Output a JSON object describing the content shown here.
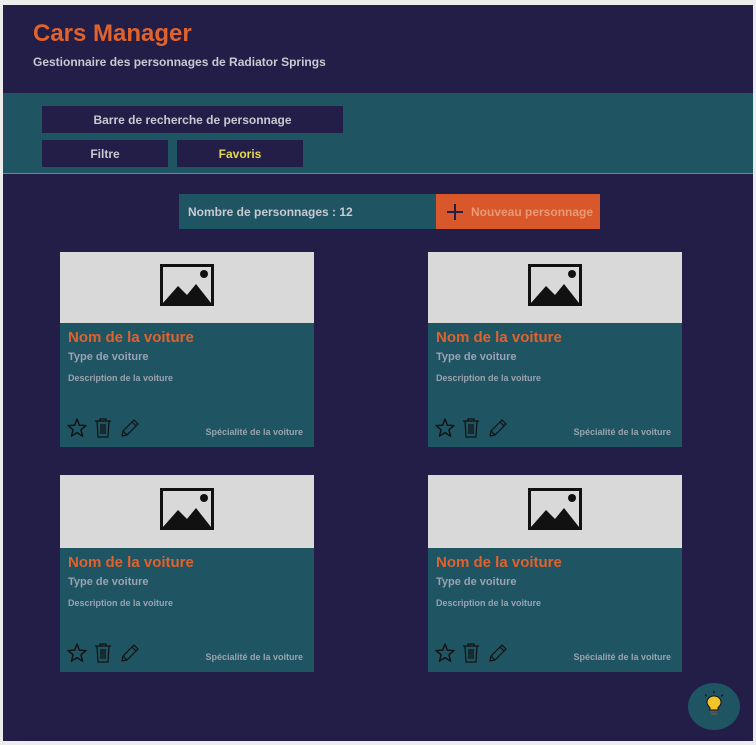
{
  "header": {
    "title": "Cars Manager",
    "subtitle": "Gestionnaire des  personnages de Radiator Springs"
  },
  "toolbar": {
    "search_label": "Barre de recherche de personnage",
    "tabs": [
      {
        "label": "Filtre"
      },
      {
        "label": "Favoris"
      }
    ]
  },
  "summary": {
    "count_label": "Nombre de personnages  : 12",
    "new_button_label": "Nouveau personnage"
  },
  "cards": [
    {
      "name": "Nom de la voiture",
      "type": "Type de voiture",
      "description": "Description de la voiture",
      "speciality": "Spécialité de la voiture"
    },
    {
      "name": "Nom de la voiture",
      "type": "Type de voiture",
      "description": "Description de la voiture",
      "speciality": "Spécialité de la voiture"
    },
    {
      "name": "Nom de la voiture",
      "type": "Type de voiture",
      "description": "Description de la voiture",
      "speciality": "Spécialité de la voiture"
    },
    {
      "name": "Nom de la voiture",
      "type": "Type de voiture",
      "description": "Description de la voiture",
      "speciality": "Spécialité de la voiture"
    }
  ],
  "icons": {
    "image_placeholder": "image-icon",
    "favorite": "star-icon",
    "delete": "trash-icon",
    "edit": "pencil-icon",
    "add": "plus-icon",
    "help": "lightbulb-icon"
  },
  "colors": {
    "background": "#221e47",
    "panel": "#1f5463",
    "accent": "#e0622c",
    "favorites_text": "#e3d94a",
    "image_bg": "#d9d9d9"
  }
}
